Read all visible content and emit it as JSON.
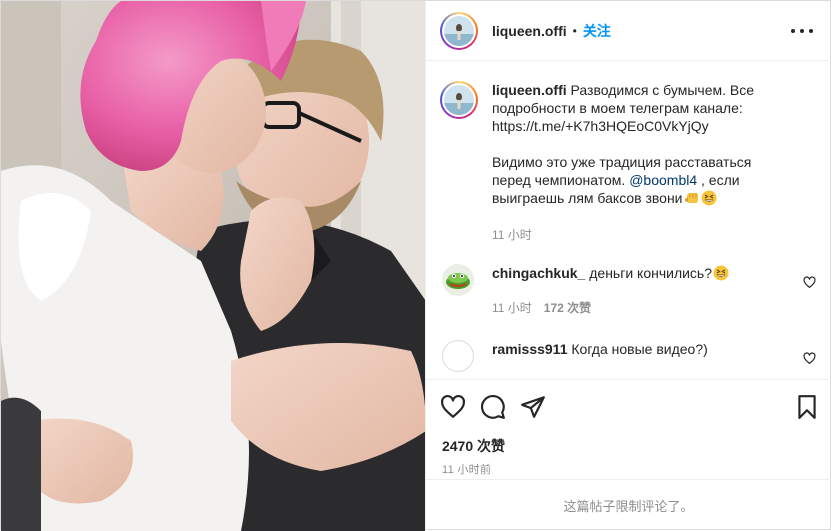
{
  "post": {
    "author": "liqueen.offi",
    "separator": "•",
    "follow_label": "关注",
    "more_icon": "more-horizontal-icon"
  },
  "caption": {
    "username": "liqueen.offi",
    "text_1": "Разводимся с бумычем. Все подробности в моем телеграм канале: https://t.me/+K7h3HQEoC0VkYjQy",
    "text_2_before": "Видимо это уже традиция расставаться перед чемпионатом.",
    "mention": "@boombl4",
    "text_2_after": ", если выиграешь лям баксов звони",
    "emojis": [
      "left-facing-fist-emoji",
      "grinning-squinting-face-emoji"
    ],
    "time": "11 小时"
  },
  "comments": [
    {
      "username": "chingachkuk_",
      "text": "деньги кончились?",
      "emoji": "grinning-squinting-face-emoji",
      "time": "11 小时",
      "likes": "172 次赞"
    },
    {
      "username": "ramisss911",
      "text": "Когда новые видео?)"
    }
  ],
  "actions": {
    "like_icon": "heart-icon",
    "comment_icon": "comment-icon",
    "share_icon": "send-icon",
    "save_icon": "bookmark-icon"
  },
  "likes_text": "2470 次赞",
  "timestamp": "11 小时前",
  "comments_limited": "这篇帖子限制评论了。",
  "colors": {
    "link_blue": "#0095f6",
    "mention_blue": "#00376b",
    "muted": "#8e8e8e",
    "text": "#262626"
  }
}
